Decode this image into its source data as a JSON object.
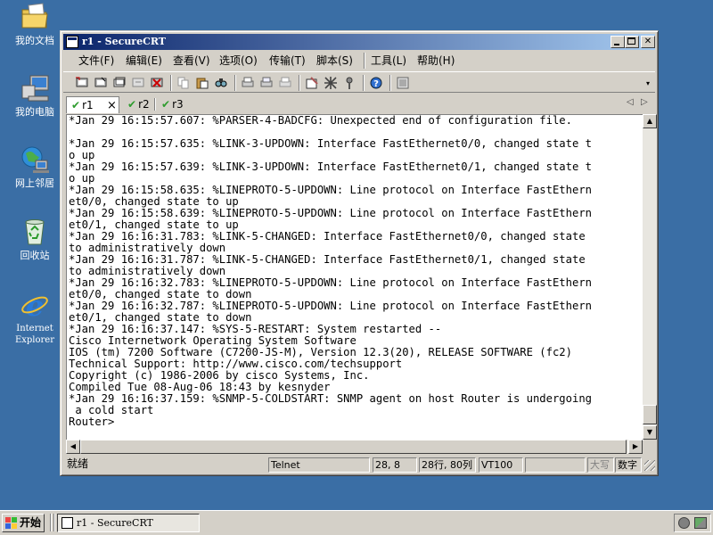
{
  "desktop": {
    "icons": [
      {
        "label": "我的文档",
        "icon": "my-documents-folder"
      },
      {
        "label": "我的电脑",
        "icon": "my-computer"
      },
      {
        "label": "网上邻居",
        "icon": "network-places"
      },
      {
        "label": "回收站",
        "icon": "recycle-bin"
      },
      {
        "label": "Internet Explorer",
        "icon": "internet-explorer"
      }
    ]
  },
  "window": {
    "title": "r1 - SecureCRT",
    "menus": [
      "文件(F)",
      "编辑(E)",
      "查看(V)",
      "选项(O)",
      "传输(T)",
      "脚本(S)",
      "工具(L)",
      "帮助(H)"
    ],
    "toolbar_icons": [
      "connect-icon",
      "quick-connect-icon",
      "connect-tab-icon",
      "reconnect-icon",
      "disconnect-icon",
      "copy-icon",
      "paste-icon",
      "find-icon",
      "print-setup-icon",
      "print-selection-icon",
      "print-icon",
      "session-options-icon",
      "global-options-icon",
      "keymap-icon",
      "help-icon",
      "sftp-icon"
    ],
    "tabs": [
      {
        "label": "r1",
        "active": true,
        "close": "×"
      },
      {
        "label": "r2",
        "active": false
      },
      {
        "label": "r3",
        "active": false
      }
    ],
    "terminal_lines": [
      "*Jan 29 16:15:57.607: %PARSER-4-BADCFG: Unexpected end of configuration file.",
      "",
      "*Jan 29 16:15:57.635: %LINK-3-UPDOWN: Interface FastEthernet0/0, changed state t",
      "o up",
      "*Jan 29 16:15:57.639: %LINK-3-UPDOWN: Interface FastEthernet0/1, changed state t",
      "o up",
      "*Jan 29 16:15:58.635: %LINEPROTO-5-UPDOWN: Line protocol on Interface FastEthern",
      "et0/0, changed state to up",
      "*Jan 29 16:15:58.639: %LINEPROTO-5-UPDOWN: Line protocol on Interface FastEthern",
      "et0/1, changed state to up",
      "*Jan 29 16:16:31.783: %LINK-5-CHANGED: Interface FastEthernet0/0, changed state",
      "to administratively down",
      "*Jan 29 16:16:31.787: %LINK-5-CHANGED: Interface FastEthernet0/1, changed state",
      "to administratively down",
      "*Jan 29 16:16:32.783: %LINEPROTO-5-UPDOWN: Line protocol on Interface FastEthern",
      "et0/0, changed state to down",
      "*Jan 29 16:16:32.787: %LINEPROTO-5-UPDOWN: Line protocol on Interface FastEthern",
      "et0/1, changed state to down",
      "*Jan 29 16:16:37.147: %SYS-5-RESTART: System restarted --",
      "Cisco Internetwork Operating System Software",
      "IOS (tm) 7200 Software (C7200-JS-M), Version 12.3(20), RELEASE SOFTWARE (fc2)",
      "Technical Support: http://www.cisco.com/techsupport",
      "Copyright (c) 1986-2006 by cisco Systems, Inc.",
      "Compiled Tue 08-Aug-06 18:43 by kesnyder",
      "*Jan 29 16:16:37.159: %SNMP-5-COLDSTART: SNMP agent on host Router is undergoing",
      " a cold start",
      "Router>"
    ],
    "status": {
      "ready": "就绪",
      "protocol": "Telnet",
      "cursor": "28, 8",
      "size": "28行, 80列",
      "emulation": "VT100",
      "blank": "",
      "caps": "大写",
      "num": "数字"
    }
  },
  "taskbar": {
    "start_label": "开始",
    "task_label": "r1 - SecureCRT"
  }
}
